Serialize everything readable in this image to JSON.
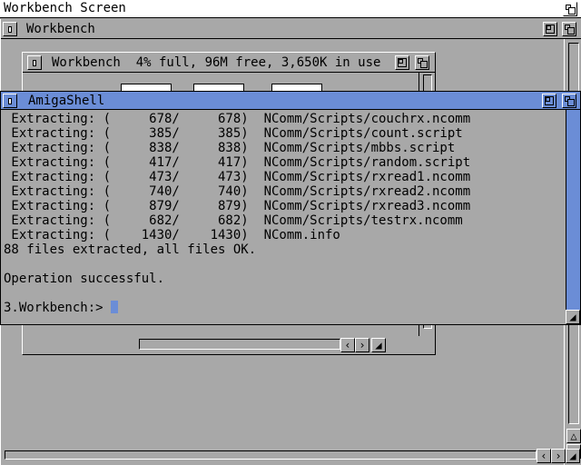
{
  "screen": {
    "title": "Workbench Screen"
  },
  "workbench_window": {
    "title": "Workbench"
  },
  "disk_window": {
    "title": "Workbench  4% full, 96M free, 3,650K in use"
  },
  "shell": {
    "title": "AmigaShell",
    "lines": [
      " Extracting: (     678/     678)  NComm/Scripts/couchrx.ncomm",
      " Extracting: (     385/     385)  NComm/Scripts/count.script",
      " Extracting: (     838/     838)  NComm/Scripts/mbbs.script",
      " Extracting: (     417/     417)  NComm/Scripts/random.script",
      " Extracting: (     473/     473)  NComm/Scripts/rxread1.ncomm",
      " Extracting: (     740/     740)  NComm/Scripts/rxread2.ncomm",
      " Extracting: (     879/     879)  NComm/Scripts/rxread3.ncomm",
      " Extracting: (     682/     682)  NComm/Scripts/testrx.ncomm",
      " Extracting: (    1430/    1430)  NComm.info",
      "88 files extracted, all files OK.",
      "",
      "Operation successful.",
      "",
      "3.Workbench:> "
    ],
    "cursor_color": "#6b8dd6"
  },
  "icons": {
    "close": "close-box-icon",
    "depth": "depth-arrange-icon",
    "zoom": "zoom-icon",
    "size": "resize-icon",
    "left": "arrow-left-icon",
    "right": "arrow-right-icon",
    "up": "arrow-up-icon",
    "down": "arrow-down-icon"
  },
  "colors": {
    "background": "#a8a8a8",
    "active_title": "#6b8dd6",
    "text": "#000000",
    "highlight": "#ffffff"
  }
}
